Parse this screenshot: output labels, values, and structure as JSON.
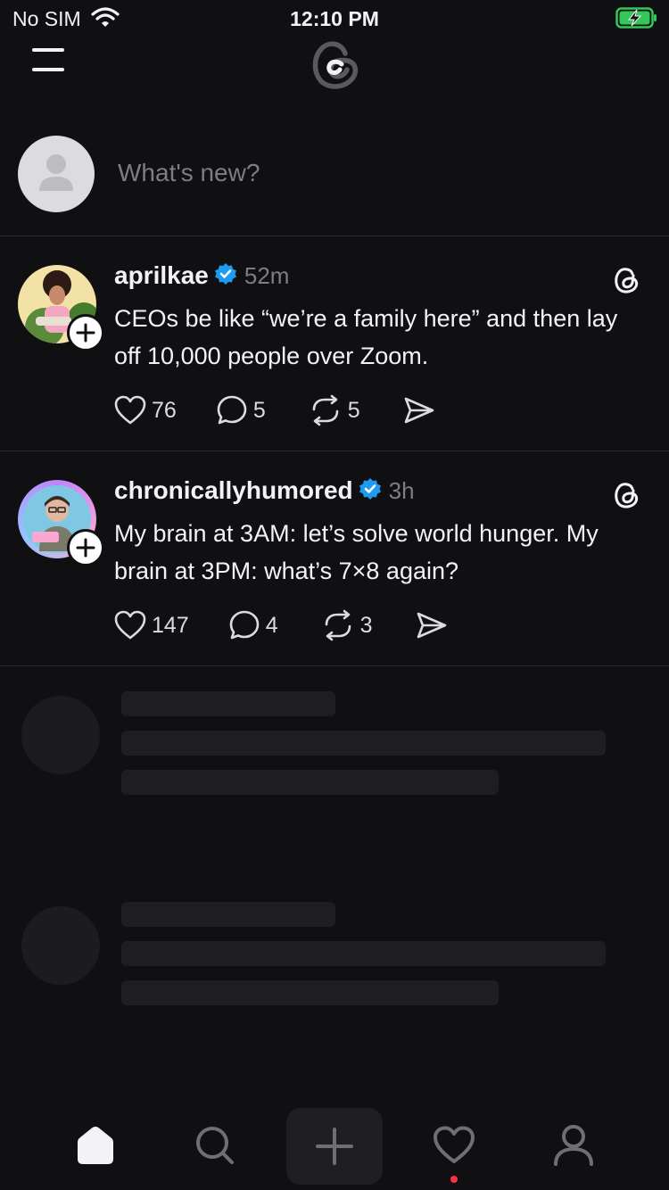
{
  "status_bar": {
    "carrier": "No SIM",
    "time": "12:10 PM"
  },
  "composer": {
    "placeholder": "What's new?"
  },
  "posts": [
    {
      "username": "aprilkae",
      "time_ago": "52m",
      "text": "CEOs be like “we’re a family here” and then lay off 10,000 people over Zoom.",
      "likes": "76",
      "replies": "5",
      "reposts": "5"
    },
    {
      "username": "chronicallyhumored",
      "time_ago": "3h",
      "text": "My brain at 3AM: let’s solve world hunger. My brain at 3PM: what’s 7×8 again?",
      "likes": "147",
      "replies": "4",
      "reposts": "3"
    }
  ],
  "tabs": [
    "home-icon",
    "search-icon",
    "compose-icon",
    "heart-icon",
    "profile-icon"
  ],
  "colors": {
    "background": "#101012",
    "verified": "#1d9bf0",
    "notification": "#ff3040",
    "battery": "#34c759"
  }
}
